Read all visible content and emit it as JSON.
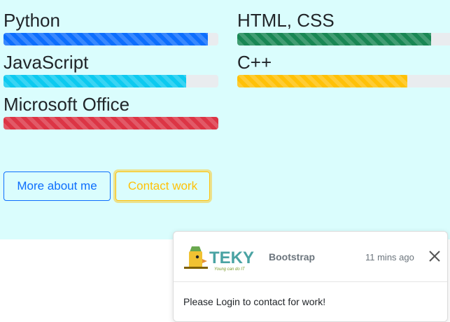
{
  "skills": [
    {
      "label": "Python",
      "progress": 0.95,
      "color": "#0d6efd"
    },
    {
      "label": "HTML, CSS",
      "progress": 0.91,
      "color": "#198754"
    },
    {
      "label": "JavaScript",
      "progress": 0.85,
      "color": "#0dcaf0"
    },
    {
      "label": "C++",
      "progress": 0.8,
      "color": "#ffc107"
    },
    {
      "label": "Microsoft Office",
      "progress": 1.0,
      "color": "#dc3545"
    }
  ],
  "buttons": {
    "about_label": "More about me",
    "contact_label": "Contact work"
  },
  "toast": {
    "logo_text": "TEKY",
    "logo_tagline": "Young can do IT",
    "title": "Bootstrap",
    "time": "11 mins ago",
    "body": "Please Login to contact for work!"
  },
  "colors": {
    "panel_bg": "#dafdfd",
    "primary": "#0d6efd",
    "warning": "#ffc107"
  }
}
